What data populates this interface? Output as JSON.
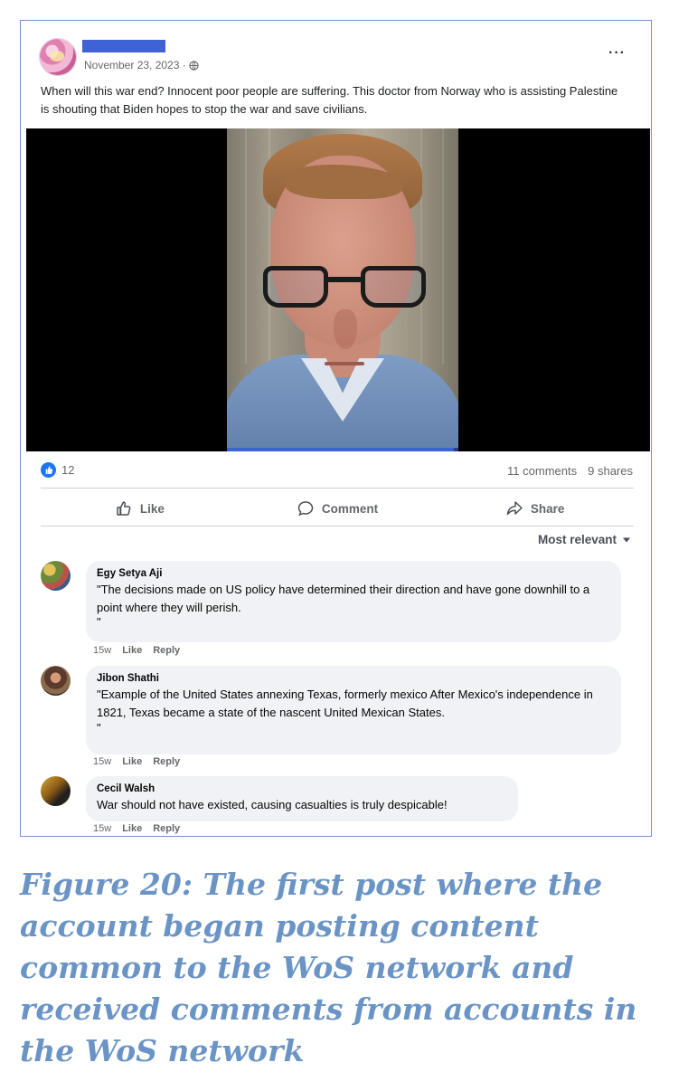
{
  "post": {
    "date": "November 23, 2023 ·",
    "privacy_icon": "globe-icon",
    "more_icon": "more-options-icon",
    "text": "When will this war end? Innocent poor people are suffering. This doctor from Norway who is assisting Palestine is shouting that Biden hopes to stop the war and save civilians.",
    "video_progress_fraction": 0.98,
    "reaction_count": "12",
    "comments_count": "11 comments",
    "shares_count": "9 shares"
  },
  "actions": {
    "like_label": "Like",
    "comment_label": "Comment",
    "share_label": "Share"
  },
  "sort_label": "Most relevant",
  "comments": [
    {
      "name": "Egy Setya Aji",
      "text": "\"The decisions made on US policy have determined their direction and have gone downhill to a point where they will perish.",
      "trail": "\"",
      "time": "15w",
      "like": "Like",
      "reply": "Reply"
    },
    {
      "name": "Jibon Shathi",
      "text": "\"Example of the United States annexing Texas, formerly mexico After Mexico's independence in 1821, Texas became a state of the nascent United Mexican States.",
      "trail": "\"",
      "time": "15w",
      "like": "Like",
      "reply": "Reply"
    },
    {
      "name": "Cecil Walsh",
      "text": "War should not have existed, causing casualties is truly despicable!",
      "time": "15w",
      "like": "Like",
      "reply": "Reply"
    }
  ],
  "caption": "Figure 20: The first post where the account began posting content common to the WoS network and received comments from accounts in the WoS network",
  "colors": {
    "accent": "#1877f2",
    "frame_border": "#6f95c8",
    "caption": "#6b94c6",
    "redaction": "#3f63d4"
  }
}
